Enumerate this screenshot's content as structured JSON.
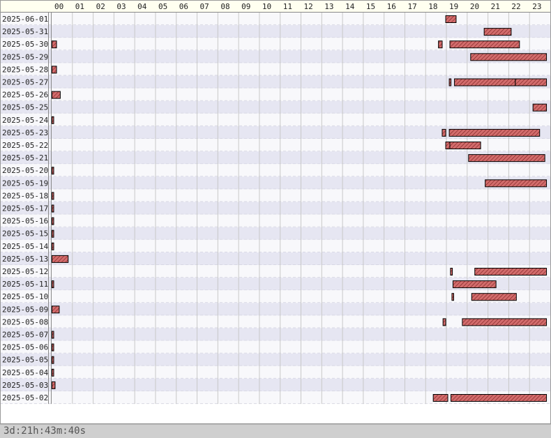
{
  "chart_data": {
    "type": "gantt",
    "x_unit": "hour of day",
    "x_range": [
      0,
      24
    ],
    "hours": [
      "00",
      "01",
      "02",
      "03",
      "04",
      "05",
      "06",
      "07",
      "08",
      "09",
      "10",
      "11",
      "12",
      "13",
      "14",
      "15",
      "16",
      "17",
      "18",
      "19",
      "20",
      "21",
      "22",
      "23"
    ],
    "rows": [
      {
        "date": "2025-06-01",
        "intervals": [
          [
            18.95,
            19.45
          ]
        ]
      },
      {
        "date": "2025-05-31",
        "intervals": [
          [
            20.8,
            22.1
          ]
        ]
      },
      {
        "date": "2025-05-30",
        "intervals": [
          [
            0.0,
            0.22
          ],
          [
            18.6,
            18.78
          ],
          [
            19.15,
            22.5
          ]
        ]
      },
      {
        "date": "2025-05-29",
        "intervals": [
          [
            20.15,
            23.8
          ]
        ]
      },
      {
        "date": "2025-05-28",
        "intervals": [
          [
            0.0,
            0.22
          ]
        ]
      },
      {
        "date": "2025-05-27",
        "intervals": [
          [
            19.12,
            19.2
          ],
          [
            19.37,
            22.3
          ],
          [
            22.3,
            23.8
          ]
        ]
      },
      {
        "date": "2025-05-26",
        "intervals": [
          [
            0.0,
            0.4
          ]
        ]
      },
      {
        "date": "2025-05-25",
        "intervals": [
          [
            23.15,
            23.8
          ]
        ]
      },
      {
        "date": "2025-05-24",
        "intervals": [
          [
            0.0,
            0.07
          ]
        ]
      },
      {
        "date": "2025-05-23",
        "intervals": [
          [
            18.78,
            18.95
          ],
          [
            19.12,
            23.47
          ]
        ]
      },
      {
        "date": "2025-05-22",
        "intervals": [
          [
            18.95,
            19.15
          ],
          [
            19.15,
            20.63
          ]
        ]
      },
      {
        "date": "2025-05-21",
        "intervals": [
          [
            20.05,
            23.72
          ]
        ]
      },
      {
        "date": "2025-05-20",
        "intervals": [
          [
            0.0,
            0.07
          ]
        ]
      },
      {
        "date": "2025-05-19",
        "intervals": [
          [
            20.85,
            23.8
          ]
        ]
      },
      {
        "date": "2025-05-18",
        "intervals": [
          [
            0.0,
            0.07
          ]
        ]
      },
      {
        "date": "2025-05-17",
        "intervals": [
          [
            0.0,
            0.07
          ]
        ]
      },
      {
        "date": "2025-05-16",
        "intervals": [
          [
            0.0,
            0.07
          ]
        ]
      },
      {
        "date": "2025-05-15",
        "intervals": [
          [
            0.0,
            0.07
          ]
        ]
      },
      {
        "date": "2025-05-14",
        "intervals": [
          [
            0.0,
            0.07
          ]
        ]
      },
      {
        "date": "2025-05-13",
        "intervals": [
          [
            0.0,
            0.78
          ]
        ]
      },
      {
        "date": "2025-05-12",
        "intervals": [
          [
            19.18,
            19.27
          ],
          [
            20.35,
            23.8
          ]
        ]
      },
      {
        "date": "2025-05-11",
        "intervals": [
          [
            0.0,
            0.07
          ],
          [
            19.3,
            21.37
          ]
        ]
      },
      {
        "date": "2025-05-10",
        "intervals": [
          [
            19.25,
            19.32
          ],
          [
            20.2,
            22.35
          ]
        ]
      },
      {
        "date": "2025-05-09",
        "intervals": [
          [
            0.0,
            0.35
          ]
        ]
      },
      {
        "date": "2025-05-08",
        "intervals": [
          [
            18.82,
            18.95
          ],
          [
            19.75,
            23.8
          ]
        ]
      },
      {
        "date": "2025-05-07",
        "intervals": [
          [
            0.0,
            0.07
          ]
        ]
      },
      {
        "date": "2025-05-06",
        "intervals": [
          [
            0.0,
            0.07
          ]
        ]
      },
      {
        "date": "2025-05-05",
        "intervals": [
          [
            0.0,
            0.07
          ]
        ]
      },
      {
        "date": "2025-05-04",
        "intervals": [
          [
            0.0,
            0.07
          ]
        ]
      },
      {
        "date": "2025-05-03",
        "intervals": [
          [
            0.0,
            0.15
          ]
        ]
      },
      {
        "date": "2025-05-02",
        "intervals": [
          [
            18.35,
            19.05
          ],
          [
            19.2,
            23.8
          ]
        ]
      }
    ],
    "colors": {
      "bar_fill": "#d26c6c",
      "bar_stroke": "#000000",
      "hatch": "#7a1e1e",
      "header_bg": "#fffff0",
      "row_even": "#f8f8fb",
      "row_odd": "#e6e6f2",
      "grid": "#c8c8c8"
    },
    "grid": true,
    "legend": "none"
  },
  "status": {
    "total_text": "3d:21h:43m:40s"
  }
}
